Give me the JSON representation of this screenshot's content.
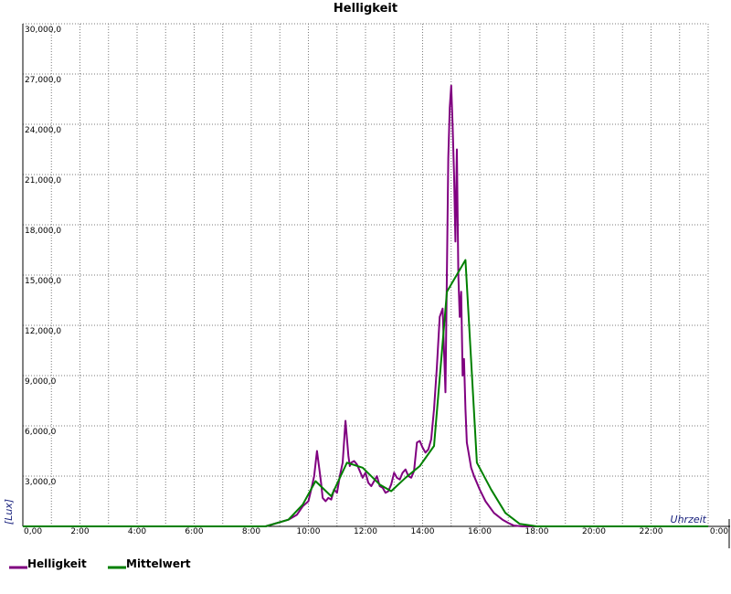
{
  "chart_data": {
    "type": "line",
    "title": "Helligkeit",
    "xlabel": "Uhrzeit",
    "ylabel": "[Lux]",
    "xlim": [
      0,
      24
    ],
    "ylim": [
      0,
      30000
    ],
    "grid": true,
    "legend_placement": "bottom-left",
    "x_ticks": [
      "0,00",
      "2:00",
      "4:00",
      "6:00",
      "8:00",
      "10:00",
      "12:00",
      "14:00",
      "16:00",
      "18:00",
      "20:00",
      "22:00",
      "0:00"
    ],
    "y_ticks": [
      "3,000,0",
      "6,000,0",
      "9,000,0",
      "12,000,0",
      "15,000,0",
      "18,000,0",
      "21,000,0",
      "24,000,0",
      "27,000,0",
      "30,000,0"
    ],
    "series": [
      {
        "name": "Helligkeit",
        "color": "#800080",
        "x": [
          0,
          8.5,
          9.3,
          9.6,
          9.8,
          10.0,
          10.1,
          10.2,
          10.3,
          10.4,
          10.45,
          10.5,
          10.6,
          10.7,
          10.8,
          10.9,
          11.0,
          11.1,
          11.2,
          11.3,
          11.4,
          11.45,
          11.5,
          11.6,
          11.7,
          11.8,
          11.9,
          12.0,
          12.1,
          12.2,
          12.3,
          12.4,
          12.5,
          12.6,
          12.7,
          12.8,
          12.9,
          13.0,
          13.1,
          13.2,
          13.3,
          13.4,
          13.5,
          13.6,
          13.7,
          13.8,
          13.9,
          14.0,
          14.1,
          14.2,
          14.3,
          14.4,
          14.5,
          14.6,
          14.7,
          14.8,
          14.9,
          14.95,
          15.0,
          15.05,
          15.1,
          15.15,
          15.2,
          15.25,
          15.3,
          15.35,
          15.4,
          15.45,
          15.5,
          15.55,
          15.6,
          15.7,
          15.8,
          15.9,
          16.0,
          16.2,
          16.5,
          16.8,
          17.0,
          17.2,
          17.5,
          18.0,
          24.0
        ],
        "y": [
          0,
          0,
          400,
          700,
          1200,
          1500,
          2200,
          3000,
          4500,
          3200,
          2500,
          1700,
          1500,
          1700,
          1600,
          2200,
          2000,
          3000,
          3800,
          6300,
          4200,
          3600,
          3800,
          3900,
          3700,
          3300,
          2900,
          3200,
          2600,
          2400,
          2700,
          3000,
          2400,
          2300,
          2000,
          2100,
          2500,
          3200,
          2900,
          2800,
          3200,
          3400,
          3000,
          2900,
          3300,
          5000,
          5100,
          4700,
          4400,
          4600,
          5200,
          7000,
          9500,
          12500,
          13000,
          8000,
          22000,
          25000,
          26300,
          24000,
          21000,
          17000,
          22500,
          15000,
          12500,
          14000,
          9000,
          10000,
          7000,
          5000,
          4500,
          3500,
          3000,
          2600,
          2200,
          1500,
          800,
          400,
          200,
          50,
          0,
          0,
          0
        ]
      },
      {
        "name": "Mittelwert",
        "color": "#008000",
        "x": [
          0,
          8.5,
          9.3,
          9.8,
          10.25,
          10.8,
          11.35,
          11.9,
          12.5,
          12.9,
          13.4,
          13.9,
          14.4,
          14.85,
          15.5,
          15.9,
          16.4,
          16.9,
          17.4,
          18.0,
          24.0
        ],
        "y": [
          0,
          0,
          400,
          1300,
          2700,
          1800,
          3800,
          3500,
          2500,
          2100,
          2900,
          3600,
          4800,
          14000,
          15900,
          3800,
          2200,
          800,
          150,
          0,
          0
        ]
      }
    ]
  }
}
